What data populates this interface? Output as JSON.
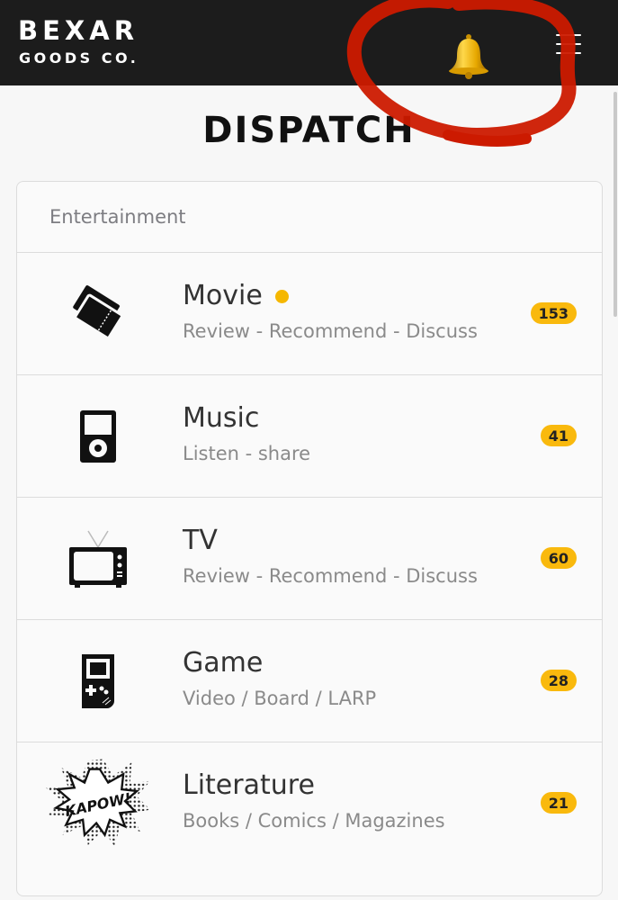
{
  "header": {
    "brand_line1": "BEXAR",
    "brand_line2": "GOODS CO.",
    "notification_icon": "bell-icon",
    "menu_icon": "hamburger-menu-icon",
    "background": "#1c1c1c"
  },
  "page": {
    "title": "DISPATCH"
  },
  "section": {
    "label": "Entertainment"
  },
  "categories": [
    {
      "name": "Movie",
      "subtitle": "Review - Recommend - Discuss",
      "count": "153",
      "unread": true,
      "icon": "ticket-icon"
    },
    {
      "name": "Music",
      "subtitle": "Listen - share",
      "count": "41",
      "unread": false,
      "icon": "music-player-icon"
    },
    {
      "name": "TV",
      "subtitle": "Review - Recommend - Discuss",
      "count": "60",
      "unread": false,
      "icon": "television-icon"
    },
    {
      "name": "Game",
      "subtitle": "Video / Board / LARP",
      "count": "28",
      "unread": false,
      "icon": "handheld-game-icon"
    },
    {
      "name": "Literature",
      "subtitle": "Books / Comics / Magazines",
      "count": "21",
      "unread": false,
      "icon": "kapow-comic-icon",
      "icon_text": "KAPOW!"
    }
  ],
  "colors": {
    "accent": "#f9b90d",
    "annotation_circle": "#cc1a00",
    "text_muted": "#8a8a8a"
  }
}
